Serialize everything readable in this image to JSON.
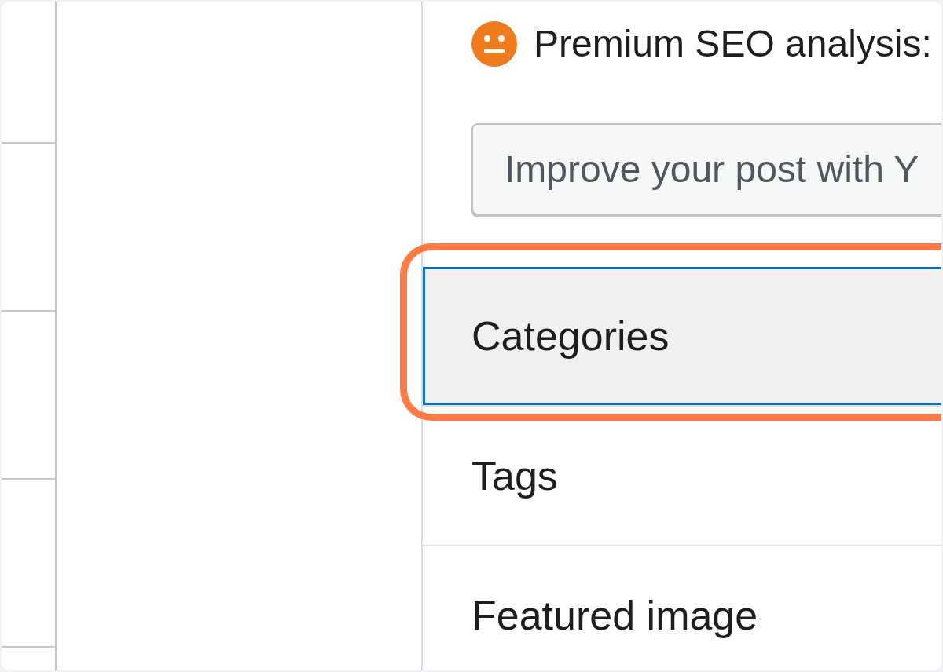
{
  "seo_analysis": {
    "label": "Premium SEO analysis:"
  },
  "improve_button": {
    "label": "Improve your post with Y"
  },
  "panels": [
    {
      "title": "Categories",
      "focused": true,
      "highlighted": true
    },
    {
      "title": "Tags",
      "focused": false,
      "highlighted": false
    },
    {
      "title": "Featured image",
      "focused": false,
      "highlighted": false
    }
  ]
}
